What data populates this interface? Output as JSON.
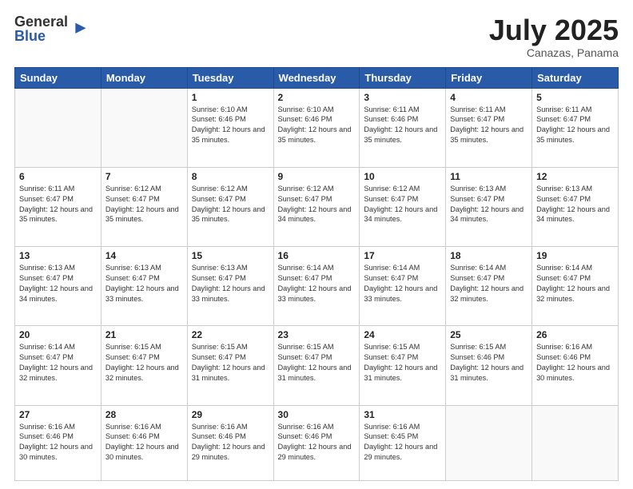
{
  "logo": {
    "general": "General",
    "blue": "Blue"
  },
  "title": "July 2025",
  "subtitle": "Canazas, Panama",
  "headers": [
    "Sunday",
    "Monday",
    "Tuesday",
    "Wednesday",
    "Thursday",
    "Friday",
    "Saturday"
  ],
  "weeks": [
    [
      {
        "day": "",
        "info": ""
      },
      {
        "day": "",
        "info": ""
      },
      {
        "day": "1",
        "info": "Sunrise: 6:10 AM\nSunset: 6:46 PM\nDaylight: 12 hours and 35 minutes."
      },
      {
        "day": "2",
        "info": "Sunrise: 6:10 AM\nSunset: 6:46 PM\nDaylight: 12 hours and 35 minutes."
      },
      {
        "day": "3",
        "info": "Sunrise: 6:11 AM\nSunset: 6:46 PM\nDaylight: 12 hours and 35 minutes."
      },
      {
        "day": "4",
        "info": "Sunrise: 6:11 AM\nSunset: 6:47 PM\nDaylight: 12 hours and 35 minutes."
      },
      {
        "day": "5",
        "info": "Sunrise: 6:11 AM\nSunset: 6:47 PM\nDaylight: 12 hours and 35 minutes."
      }
    ],
    [
      {
        "day": "6",
        "info": "Sunrise: 6:11 AM\nSunset: 6:47 PM\nDaylight: 12 hours and 35 minutes."
      },
      {
        "day": "7",
        "info": "Sunrise: 6:12 AM\nSunset: 6:47 PM\nDaylight: 12 hours and 35 minutes."
      },
      {
        "day": "8",
        "info": "Sunrise: 6:12 AM\nSunset: 6:47 PM\nDaylight: 12 hours and 35 minutes."
      },
      {
        "day": "9",
        "info": "Sunrise: 6:12 AM\nSunset: 6:47 PM\nDaylight: 12 hours and 34 minutes."
      },
      {
        "day": "10",
        "info": "Sunrise: 6:12 AM\nSunset: 6:47 PM\nDaylight: 12 hours and 34 minutes."
      },
      {
        "day": "11",
        "info": "Sunrise: 6:13 AM\nSunset: 6:47 PM\nDaylight: 12 hours and 34 minutes."
      },
      {
        "day": "12",
        "info": "Sunrise: 6:13 AM\nSunset: 6:47 PM\nDaylight: 12 hours and 34 minutes."
      }
    ],
    [
      {
        "day": "13",
        "info": "Sunrise: 6:13 AM\nSunset: 6:47 PM\nDaylight: 12 hours and 34 minutes."
      },
      {
        "day": "14",
        "info": "Sunrise: 6:13 AM\nSunset: 6:47 PM\nDaylight: 12 hours and 33 minutes."
      },
      {
        "day": "15",
        "info": "Sunrise: 6:13 AM\nSunset: 6:47 PM\nDaylight: 12 hours and 33 minutes."
      },
      {
        "day": "16",
        "info": "Sunrise: 6:14 AM\nSunset: 6:47 PM\nDaylight: 12 hours and 33 minutes."
      },
      {
        "day": "17",
        "info": "Sunrise: 6:14 AM\nSunset: 6:47 PM\nDaylight: 12 hours and 33 minutes."
      },
      {
        "day": "18",
        "info": "Sunrise: 6:14 AM\nSunset: 6:47 PM\nDaylight: 12 hours and 32 minutes."
      },
      {
        "day": "19",
        "info": "Sunrise: 6:14 AM\nSunset: 6:47 PM\nDaylight: 12 hours and 32 minutes."
      }
    ],
    [
      {
        "day": "20",
        "info": "Sunrise: 6:14 AM\nSunset: 6:47 PM\nDaylight: 12 hours and 32 minutes."
      },
      {
        "day": "21",
        "info": "Sunrise: 6:15 AM\nSunset: 6:47 PM\nDaylight: 12 hours and 32 minutes."
      },
      {
        "day": "22",
        "info": "Sunrise: 6:15 AM\nSunset: 6:47 PM\nDaylight: 12 hours and 31 minutes."
      },
      {
        "day": "23",
        "info": "Sunrise: 6:15 AM\nSunset: 6:47 PM\nDaylight: 12 hours and 31 minutes."
      },
      {
        "day": "24",
        "info": "Sunrise: 6:15 AM\nSunset: 6:47 PM\nDaylight: 12 hours and 31 minutes."
      },
      {
        "day": "25",
        "info": "Sunrise: 6:15 AM\nSunset: 6:46 PM\nDaylight: 12 hours and 31 minutes."
      },
      {
        "day": "26",
        "info": "Sunrise: 6:16 AM\nSunset: 6:46 PM\nDaylight: 12 hours and 30 minutes."
      }
    ],
    [
      {
        "day": "27",
        "info": "Sunrise: 6:16 AM\nSunset: 6:46 PM\nDaylight: 12 hours and 30 minutes."
      },
      {
        "day": "28",
        "info": "Sunrise: 6:16 AM\nSunset: 6:46 PM\nDaylight: 12 hours and 30 minutes."
      },
      {
        "day": "29",
        "info": "Sunrise: 6:16 AM\nSunset: 6:46 PM\nDaylight: 12 hours and 29 minutes."
      },
      {
        "day": "30",
        "info": "Sunrise: 6:16 AM\nSunset: 6:46 PM\nDaylight: 12 hours and 29 minutes."
      },
      {
        "day": "31",
        "info": "Sunrise: 6:16 AM\nSunset: 6:45 PM\nDaylight: 12 hours and 29 minutes."
      },
      {
        "day": "",
        "info": ""
      },
      {
        "day": "",
        "info": ""
      }
    ]
  ]
}
